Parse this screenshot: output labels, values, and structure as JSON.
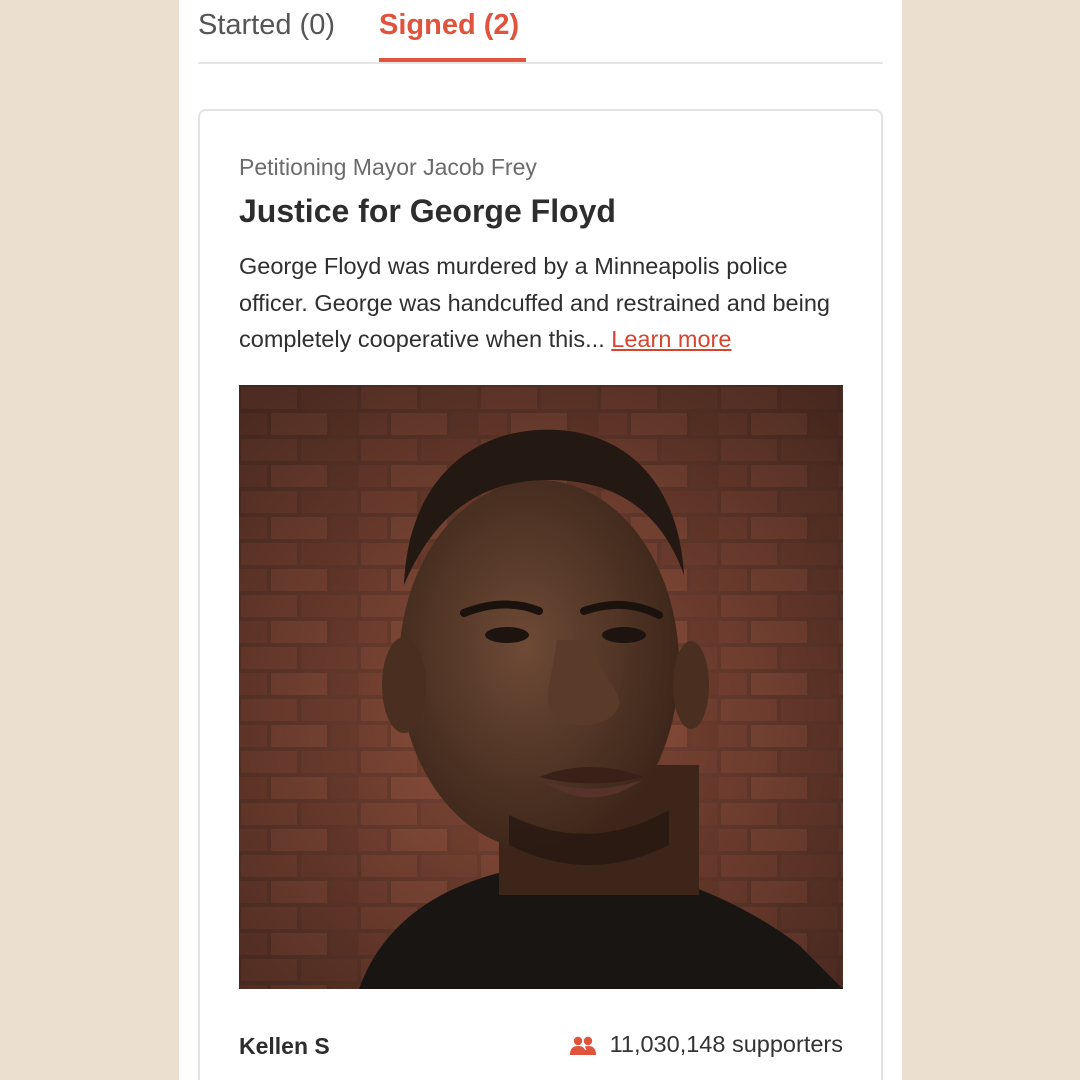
{
  "tabs": {
    "started_label": "Started (0)",
    "signed_label": "Signed (2)",
    "active": "signed"
  },
  "petition": {
    "target": "Petitioning Mayor Jacob Frey",
    "title": "Justice for George Floyd",
    "description": "George Floyd was murdered by a Minneapolis police officer. George was handcuffed and restrained and being completely cooperative when this...",
    "learn_more_label": "Learn more",
    "author": "Kellen S",
    "supporters": "11,030,148 supporters",
    "supporters_icon": "people-icon"
  },
  "colors": {
    "accent": "#e0533d",
    "background": "#ebe0d0"
  }
}
